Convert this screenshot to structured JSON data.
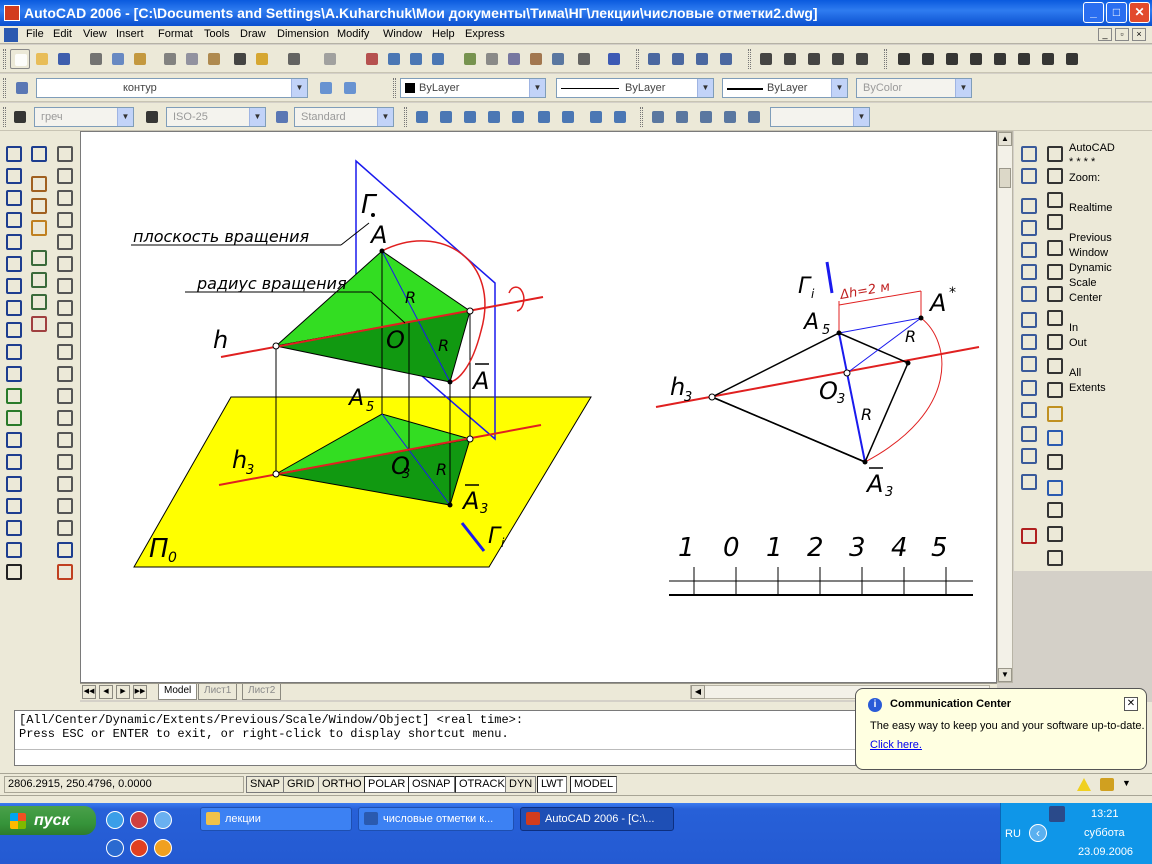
{
  "window": {
    "title": "AutoCAD 2006 - [C:\\Documents and Settings\\A.Kuharchuk\\Мои документы\\Тима\\НГ\\лекции\\числовые отметки2.dwg]",
    "minimize_label": "_",
    "maximize_label": "□",
    "close_label": "✕"
  },
  "menu": [
    "File",
    "Edit",
    "View",
    "Insert",
    "Format",
    "Tools",
    "Draw",
    "Dimension",
    "Modify",
    "Window",
    "Help",
    "Express"
  ],
  "layers_toolbar": {
    "layer_name": "контур",
    "color": "ByLayer",
    "linetype": "ByLayer",
    "lineweight": "ByLayer",
    "plotstyle": "ByColor"
  },
  "styles_toolbar": {
    "text_style": "греч",
    "dim_style": "ISO-25",
    "table_style": "Standard"
  },
  "zoom_panel": [
    "AutoCAD",
    "* * * *",
    "Zoom:",
    "Realtime",
    "Previous",
    "Window",
    "Dynamic",
    "Scale",
    "Center",
    "In",
    "Out",
    "All",
    "Extents"
  ],
  "drawing_labels": {
    "plane_rotation": "плоскость вращения",
    "radius_rotation": "радиус вращения",
    "gamma": "Г",
    "A": "A",
    "R": "R",
    "O": "O",
    "A_bar": "A",
    "h": "h",
    "A5": "A",
    "A5_sub": "5",
    "O3": "O",
    "O3_sub": "3",
    "A3_bar": "A",
    "A3_sub": "3",
    "h3": "h",
    "h3_sub": "3",
    "P0": "П",
    "P0_sub": "0",
    "gamma_i": "Г",
    "gamma_i_sub": "i",
    "dh_label": "Δh=2 м",
    "A_star": "A",
    "A_star_sup": "*",
    "scale_numbers": [
      "1",
      "0",
      "1",
      "2",
      "3",
      "4",
      "5"
    ]
  },
  "tabs": [
    "Model",
    "Лист1",
    "Лист2"
  ],
  "command_window": {
    "line1": "[All/Center/Dynamic/Extents/Previous/Scale/Window/Object] <real time>:",
    "line2": "Press ESC or ENTER to exit, or right-click to display shortcut menu."
  },
  "balloon": {
    "title": "Communication Center",
    "body": "The easy way to keep you and your software up-to-date.",
    "link": "Click here.",
    "close_label": "✕"
  },
  "status": {
    "coordinates": "2806.2915, 250.4796, 0.0000",
    "toggles": [
      "SNAP",
      "GRID",
      "ORTHO",
      "POLAR",
      "OSNAP",
      "OTRACK",
      "DYN",
      "LWT",
      "MODEL"
    ],
    "toggles_on": [
      "POLAR",
      "OSNAP",
      "OTRACK",
      "LWT",
      "MODEL"
    ]
  },
  "taskbar": {
    "start_label": "пуск",
    "tasks": [
      "лекции",
      "числовые отметки к...",
      "AutoCAD 2006 - [C:\\..."
    ],
    "lang": "RU",
    "chevron": "‹",
    "time": "13:21",
    "day": "суббота",
    "date": "23.09.2006"
  },
  "colors": {
    "accent": "#0a5ade",
    "plane_yellow": "#ffff00",
    "green_light": "#33dd22",
    "green_dark": "#119911",
    "red_line": "#e02020",
    "blue_line": "#1a1aee"
  }
}
